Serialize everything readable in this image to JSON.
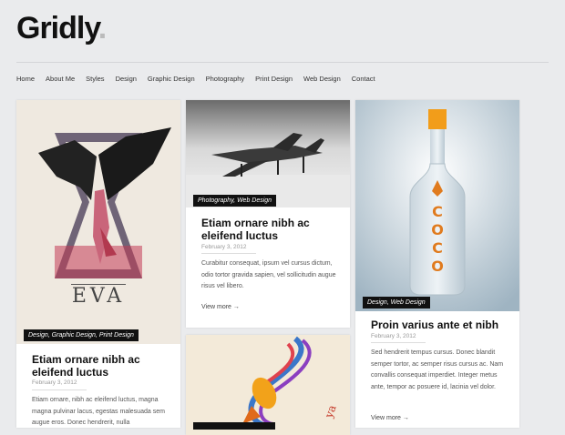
{
  "site": {
    "logo": "Gridly",
    "logo_dot": "."
  },
  "nav": [
    "Home",
    "About Me",
    "Styles",
    "Design",
    "Graphic Design",
    "Photography",
    "Print Design",
    "Web Design",
    "Contact"
  ],
  "posts": [
    {
      "tags": "Design, Graphic Design, Print Design",
      "title": "Etiam ornare nibh ac eleifend luctus",
      "date": "February 3, 2012",
      "excerpt": "Etiam ornare, nibh ac eleifend luctus, magna magna pulvinar lacus, egestas malesuada sem augue eros. Donec hendrerit, nulla"
    },
    {
      "tags": "Photography, Web Design",
      "title": "Etiam ornare nibh ac eleifend luctus",
      "date": "February 3, 2012",
      "excerpt": "Curabitur consequat, ipsum vel cursus dictum, odio tortor gravida sapien, vel sollicitudin augue risus vel libero.",
      "more": "View more →"
    },
    {
      "tags": "Design, Web Design",
      "title": "Proin varius ante et nibh",
      "date": "February 3, 2012",
      "excerpt": "Sed hendrerit tempus cursus. Donec blandit semper tortor, ac semper risus cursus ac. Nam convallis consequat imperdiet. Integer metus ante, tempor ac posuere id, lacinia vel dolor.",
      "more": "View more →"
    }
  ],
  "bottle_label": [
    "C",
    "O",
    "C",
    "O"
  ],
  "poster_text": "EVA"
}
